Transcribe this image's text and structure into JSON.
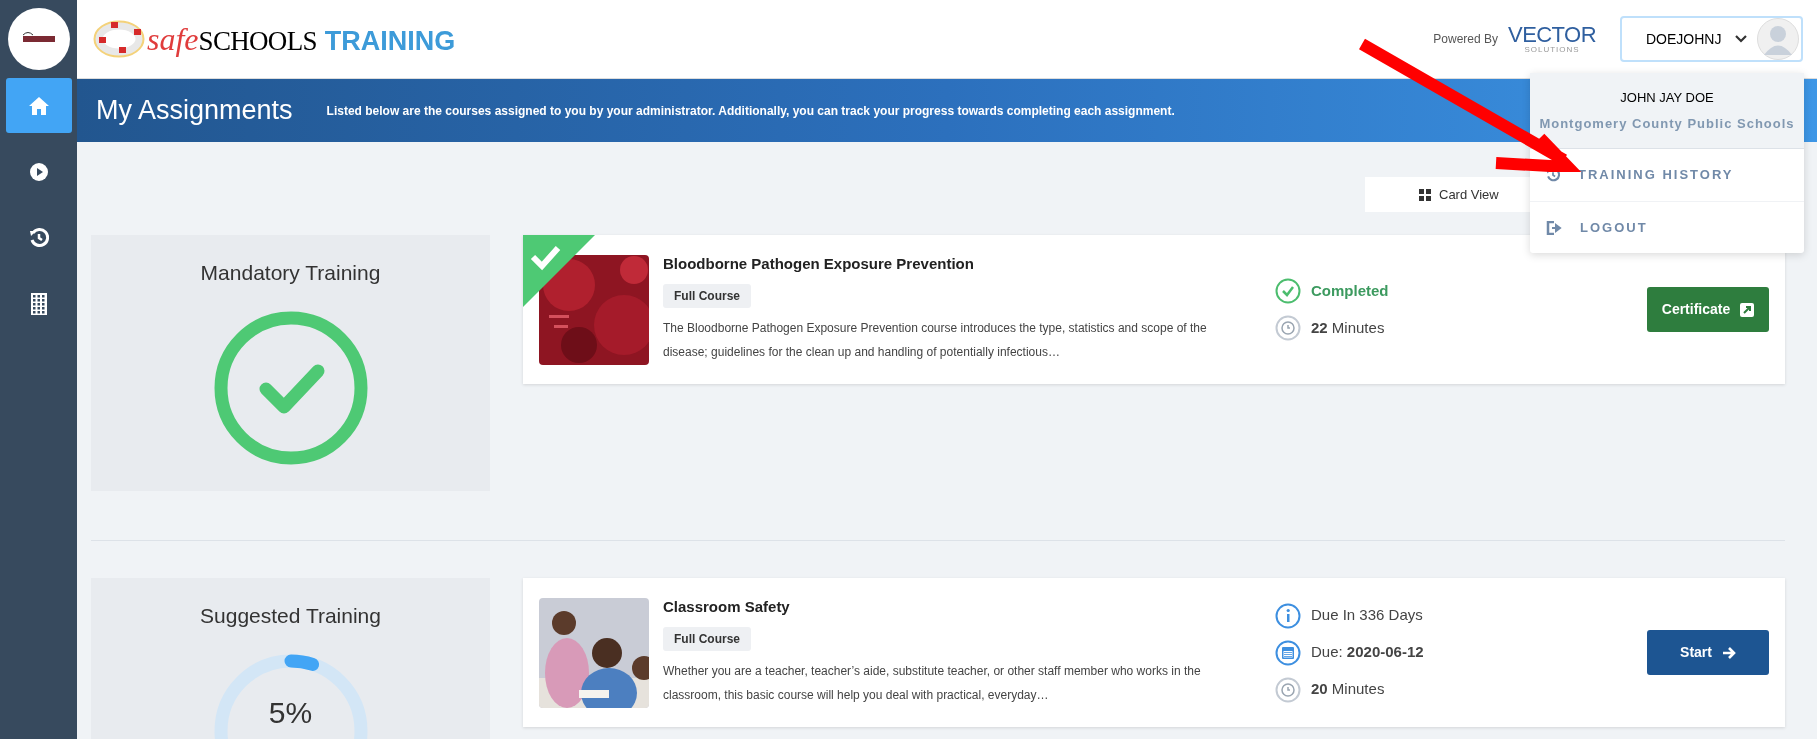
{
  "sidebar": {
    "items": [
      {
        "selected": true
      },
      {
        "selected": false
      },
      {
        "selected": false
      },
      {
        "selected": false
      }
    ]
  },
  "header": {
    "logo": {
      "part_1": "safe",
      "part_2": "SCHOOLS",
      "part_3": "TRAINING"
    },
    "powered_by": "Powered By",
    "vendor": {
      "name": "VECTOR",
      "tagline": "SOLUTIONS"
    },
    "user_button": "DOEJOHNJ"
  },
  "user_menu": {
    "name": "JOHN JAY DOE",
    "organization": "Montgomery County Public Schools",
    "items": [
      {
        "kind": "history",
        "label": "TRAINING HISTORY"
      },
      {
        "kind": "logout",
        "label": "LOGOUT"
      }
    ]
  },
  "banner": {
    "title": "My Assignments",
    "description": "Listed below are the courses assigned to you by your administrator. Additionally, you can track your progress towards completing each assignment."
  },
  "view_toggle": {
    "label": "Card View"
  },
  "sections": [
    {
      "title": "Mandatory Training",
      "kind": "complete",
      "courses": [
        {
          "title": "Bloodborne Pathogen Exposure Prevention",
          "tag": "Full Course",
          "completed": true,
          "description": "The Bloodborne Pathogen Exposure Prevention course introduces the type, statistics and scope of the disease; guidelines for the clean up and handling of potentially infectious…",
          "status": [
            {
              "kind": "completed",
              "text": "Completed"
            },
            {
              "kind": "duration",
              "text": "**22** Minutes"
            }
          ],
          "action": {
            "kind": "certificate",
            "label": "Certificate"
          }
        }
      ]
    },
    {
      "title": "Suggested Training",
      "kind": "progress",
      "level": 0.05,
      "percent": "5%",
      "courses": [
        {
          "title": "Classroom Safety",
          "tag": "Full Course",
          "completed": false,
          "description": "Whether you are a teacher, teacher’s aide, substitute teacher, or other staff member who works in the classroom, this basic course will help you deal with practical, everyday…",
          "status": [
            {
              "kind": "due_in",
              "text": "Due In 336 Days"
            },
            {
              "kind": "due_date",
              "text": "Due: **2020-06-12**"
            },
            {
              "kind": "duration",
              "text": "**20** Minutes"
            }
          ],
          "action": {
            "kind": "start",
            "label": "Start"
          }
        }
      ]
    }
  ]
}
